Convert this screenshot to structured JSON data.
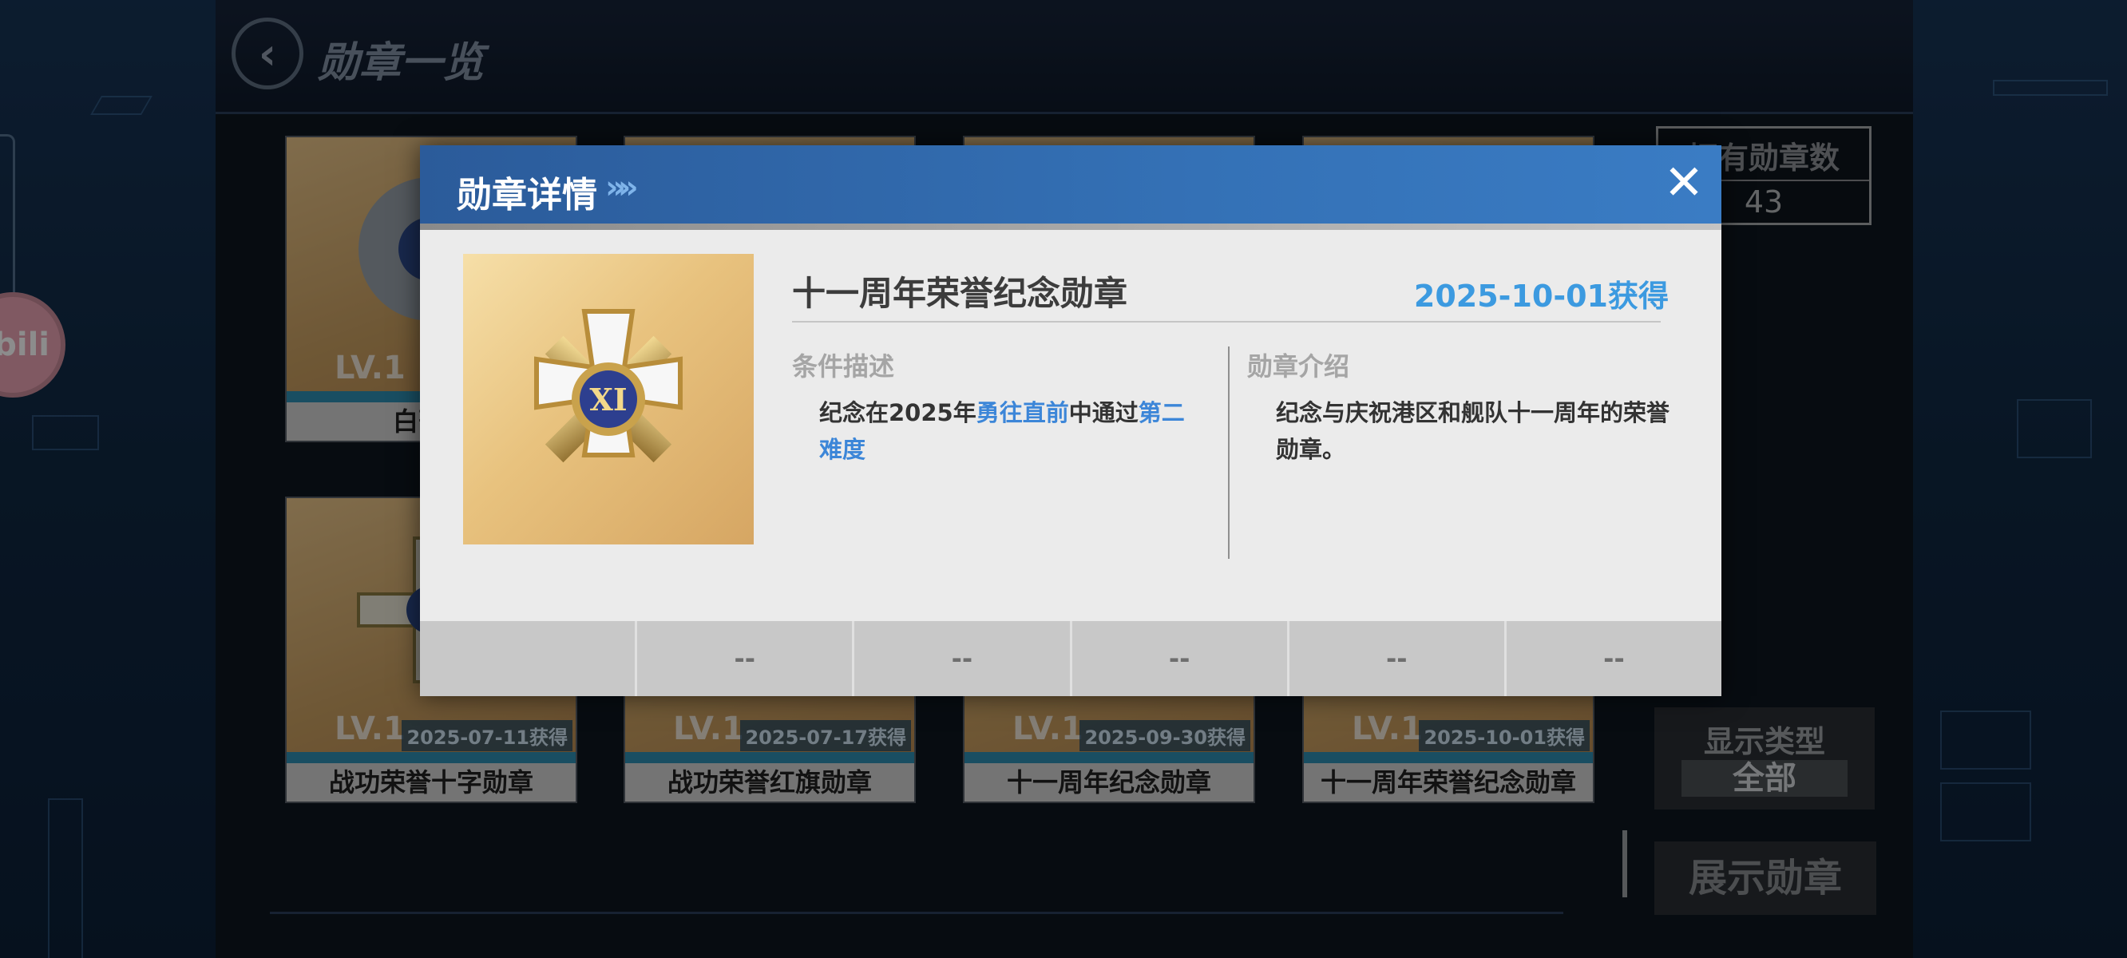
{
  "header": {
    "title": "勋章一览",
    "back_icon": "chevron-left-icon"
  },
  "stats": {
    "count_label": "拥有勋章数",
    "count_value": "43"
  },
  "filter": {
    "label": "显示类型",
    "value": "全部"
  },
  "show_button": "展示勋章",
  "bili_badge": "bili",
  "cards": [
    {
      "lv": "LV.1",
      "date": "",
      "name": "白蔷薇"
    },
    {
      "lv": "LV.1",
      "date": "2025-07-11获得",
      "name": "战功荣誉十字勋章"
    },
    {
      "lv": "LV.1",
      "date": "2025-07-17获得",
      "name": "战功荣誉红旗勋章"
    },
    {
      "lv": "LV.1",
      "date": "2025-09-30获得",
      "name": "十一周年纪念勋章"
    },
    {
      "lv": "LV.1",
      "date": "2025-10-01获得",
      "name": "十一周年荣誉纪念勋章"
    }
  ],
  "modal": {
    "title": "勋章详情",
    "chevrons": "»»",
    "close_icon": "close-icon",
    "medal_name": "十一周年荣誉纪念勋章",
    "medal_roman": "XI",
    "obtained": "2025-10-01获得",
    "condition_label": "条件描述",
    "condition": {
      "p1": "纪念在2025年",
      "h1": "勇往直前",
      "p2": "中通过",
      "h2": "第二难度"
    },
    "intro_label": "勋章介绍",
    "intro": "纪念与庆祝港区和舰队十一周年的荣誉勋章。",
    "slots": [
      "",
      "--",
      "--",
      "--",
      "--",
      "--"
    ]
  },
  "colors": {
    "accent_blue": "#3c9ae0",
    "header_blue": "#3471b6",
    "highlight": "#3c86d8"
  }
}
